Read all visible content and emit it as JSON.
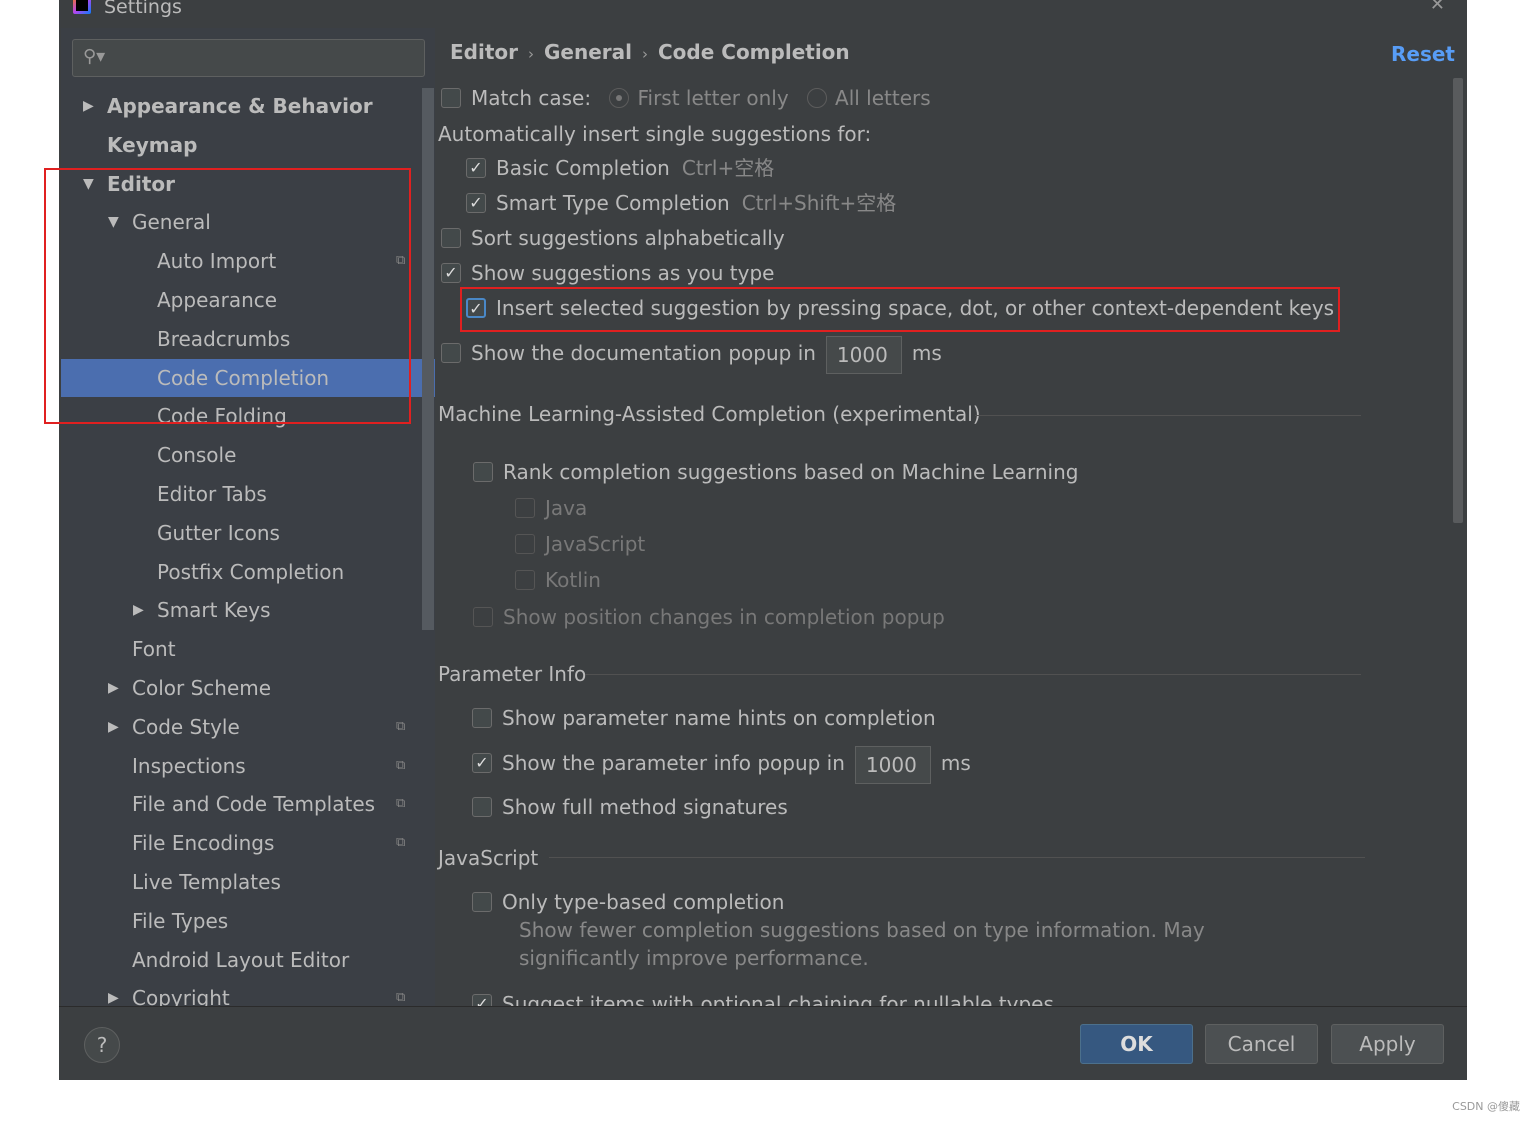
{
  "window": {
    "title": "Settings",
    "close_icon": "close-icon"
  },
  "search": {
    "placeholder": "",
    "icon": "search-icon"
  },
  "tree": [
    {
      "label": "Appearance & Behavior",
      "bold": true,
      "arrow": "right",
      "indent": 0
    },
    {
      "label": "Keymap",
      "bold": true,
      "indent": 0
    },
    {
      "label": "Editor",
      "bold": true,
      "arrow": "down",
      "indent": 0
    },
    {
      "label": "General",
      "arrow": "down",
      "indent": 1
    },
    {
      "label": "Auto Import",
      "indent": 2,
      "copy": true
    },
    {
      "label": "Appearance",
      "indent": 2
    },
    {
      "label": "Breadcrumbs",
      "indent": 2
    },
    {
      "label": "Code Completion",
      "indent": 2,
      "selected": true
    },
    {
      "label": "Code Folding",
      "indent": 2
    },
    {
      "label": "Console",
      "indent": 2
    },
    {
      "label": "Editor Tabs",
      "indent": 2
    },
    {
      "label": "Gutter Icons",
      "indent": 2
    },
    {
      "label": "Postfix Completion",
      "indent": 2
    },
    {
      "label": "Smart Keys",
      "arrow": "right",
      "indent": 2
    },
    {
      "label": "Font",
      "indent": 1
    },
    {
      "label": "Color Scheme",
      "arrow": "right",
      "indent": 1
    },
    {
      "label": "Code Style",
      "arrow": "right",
      "indent": 1,
      "copy": true
    },
    {
      "label": "Inspections",
      "indent": 1,
      "copy": true
    },
    {
      "label": "File and Code Templates",
      "indent": 1,
      "copy": true
    },
    {
      "label": "File Encodings",
      "indent": 1,
      "copy": true
    },
    {
      "label": "Live Templates",
      "indent": 1
    },
    {
      "label": "File Types",
      "indent": 1
    },
    {
      "label": "Android Layout Editor",
      "indent": 1
    },
    {
      "label": "Copyright",
      "arrow": "right",
      "indent": 1,
      "copy": true
    }
  ],
  "breadcrumb": [
    "Editor",
    "General",
    "Code Completion"
  ],
  "reset": "Reset",
  "match_case": {
    "label": "Match case:",
    "checked": false,
    "options": [
      "First letter only",
      "All letters"
    ],
    "selected": "First letter only"
  },
  "auto_insert_label": "Automatically insert single suggestions for:",
  "basic": {
    "label": "Basic Completion",
    "shortcut": "Ctrl+空格",
    "checked": true
  },
  "smart": {
    "label": "Smart Type Completion",
    "shortcut": "Ctrl+Shift+空格",
    "checked": true
  },
  "sort": {
    "label": "Sort suggestions alphabetically",
    "checked": false
  },
  "show_as_type": {
    "label": "Show suggestions as you type",
    "checked": true
  },
  "insert_selected": {
    "label": "Insert selected suggestion by pressing space, dot, or other context-dependent keys",
    "checked": true
  },
  "doc_popup": {
    "label": "Show the documentation popup in",
    "value": "1000",
    "unit": "ms",
    "checked": false
  },
  "ml": {
    "title": "Machine Learning-Assisted Completion (experimental)",
    "rank": {
      "label": "Rank completion suggestions based on Machine Learning",
      "checked": false
    },
    "langs": [
      "Java",
      "JavaScript",
      "Kotlin"
    ],
    "position": "Show position changes in completion popup"
  },
  "param": {
    "title": "Parameter Info",
    "hints": {
      "label": "Show parameter name hints on completion",
      "checked": false
    },
    "popup": {
      "label": "Show the parameter info popup in",
      "value": "1000",
      "unit": "ms",
      "checked": true
    },
    "full": {
      "label": "Show full method signatures",
      "checked": false
    }
  },
  "js": {
    "title": "JavaScript",
    "type_based": {
      "label": "Only type-based completion",
      "checked": false
    },
    "desc1": "Show fewer completion suggestions based on type information. May",
    "desc2": "significantly improve performance.",
    "optional_chaining": {
      "label": "Suggest items with optional chaining for nullable types",
      "checked": true
    }
  },
  "buttons": {
    "ok": "OK",
    "cancel": "Cancel",
    "apply": "Apply",
    "help": "?"
  },
  "highlight_color": "#e02020",
  "selection_color": "#4b6eaf",
  "accent": "#589df6",
  "watermark": "CSDN @傻藏"
}
